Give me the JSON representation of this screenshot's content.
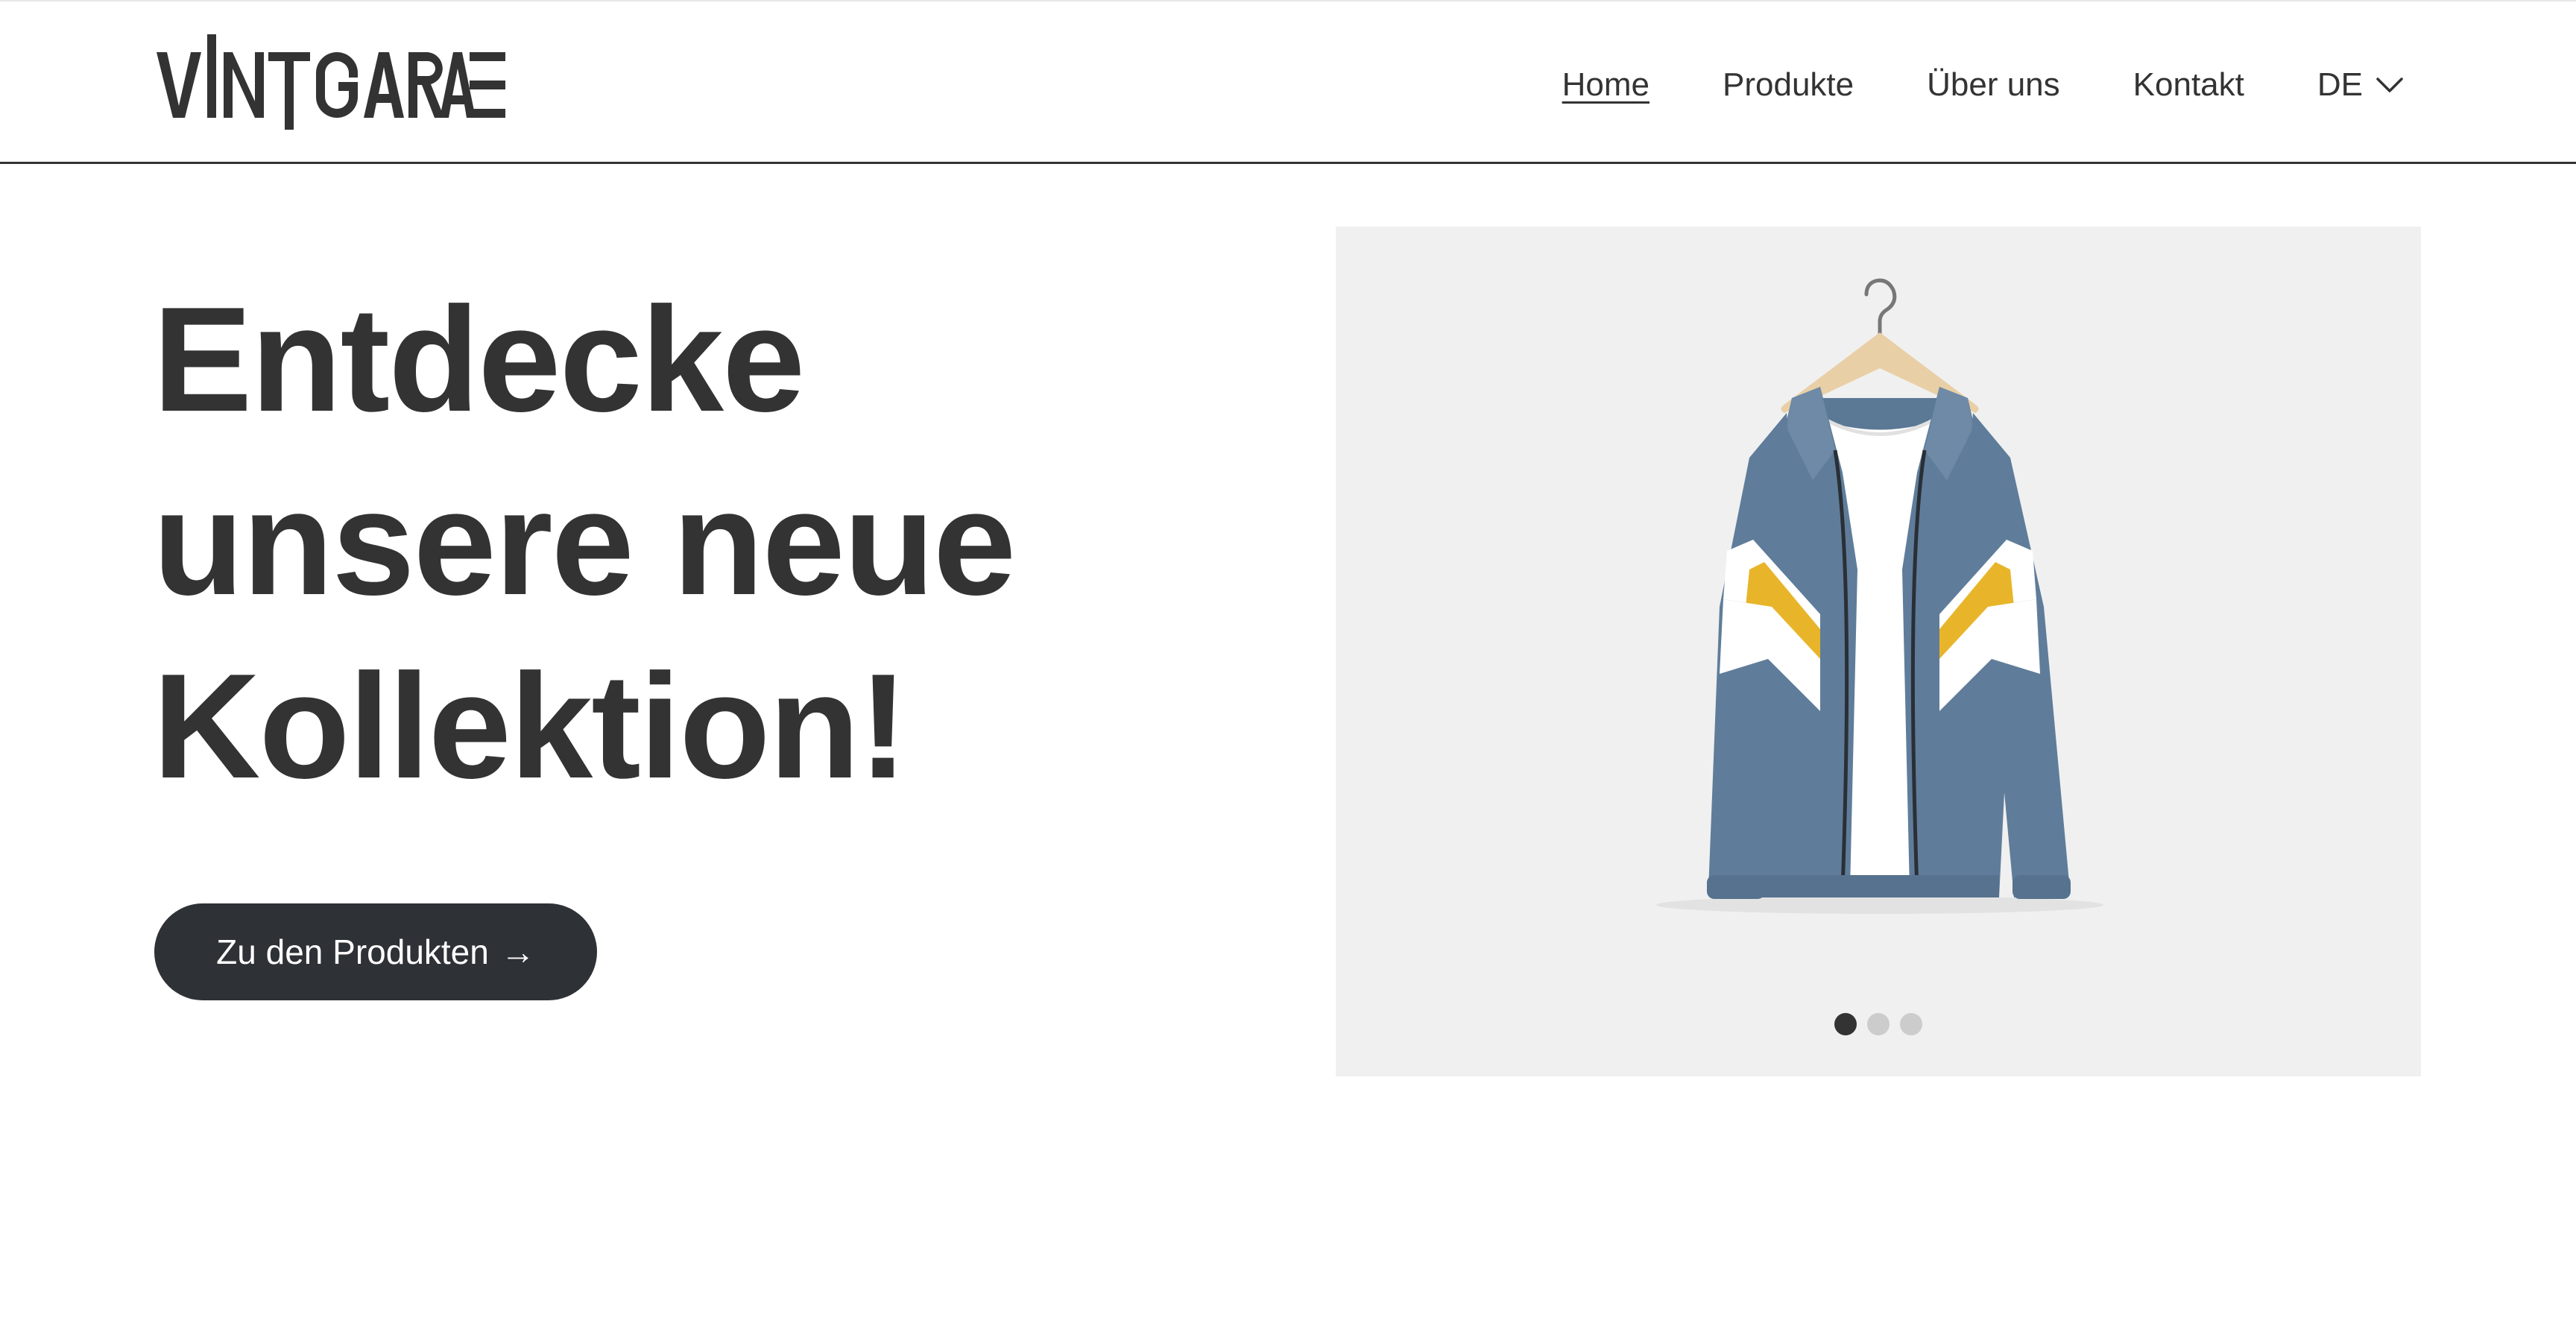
{
  "brand": {
    "logo_text": "VINTGARAGE",
    "logo_icon": "vintgarage-wordmark"
  },
  "nav": {
    "items": [
      {
        "label": "Home",
        "active": true
      },
      {
        "label": "Produkte",
        "active": false
      },
      {
        "label": "Über uns",
        "active": false
      },
      {
        "label": "Kontakt",
        "active": false
      }
    ],
    "language": {
      "label": "DE",
      "icon": "chevron-down-icon"
    }
  },
  "hero": {
    "title_lines": [
      "Entdecke",
      "unsere neue",
      "Kollektion!"
    ],
    "cta_label": "Zu den Produkten",
    "cta_icon": "arrow-right-icon",
    "cta_arrow": "→"
  },
  "carousel": {
    "image": "jacket-on-hanger",
    "slide_count": 3,
    "active_slide": 1
  },
  "colors": {
    "text": "#333333",
    "button_bg": "#2e3135",
    "button_text": "#ffffff",
    "carousel_bg": "#f0f0f0",
    "jacket_blue": "#5f7d9a",
    "jacket_yellow": "#e8b52a",
    "dot_active": "#333333",
    "dot_inactive": "#cccccc"
  }
}
